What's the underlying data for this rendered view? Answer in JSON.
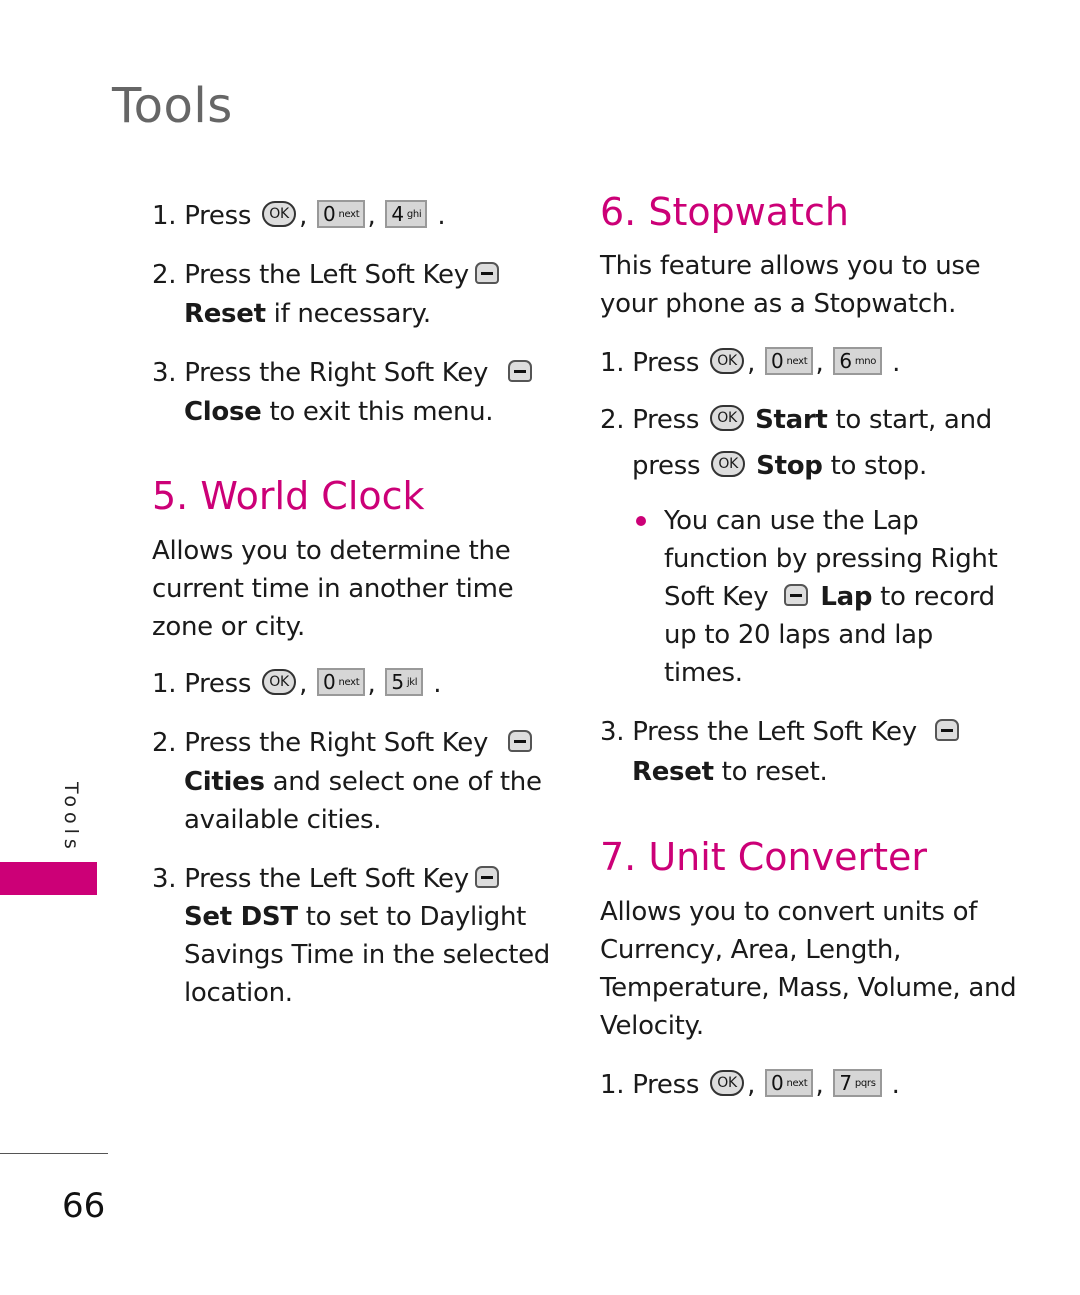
{
  "page": {
    "title": "Tools",
    "side_tab": "Tools",
    "page_number": "66",
    "accent_color": "#cc0077"
  },
  "intro_steps": [
    {
      "num": "1.",
      "text": "Press",
      "keys": [
        "OK",
        "0 next",
        "4 ghi"
      ]
    },
    {
      "num": "2.",
      "text": "Press the Left Soft Key",
      "bold": "Reset",
      "rest": "if necessary."
    },
    {
      "num": "3.",
      "text": "Press the Right Soft Key",
      "bold": "Close",
      "rest": "to exit this menu."
    }
  ],
  "world_clock": {
    "heading": "5. World Clock",
    "description": [
      "Allows you to determine the",
      "current time in another time",
      "zone or city."
    ],
    "step1": {
      "num": "1.",
      "text": "Press",
      "keys": {
        "ok": "OK",
        "k1": "0",
        "k1sub": "next",
        "k2": "5",
        "k2sub": "jkl"
      }
    },
    "step2": {
      "num": "2.",
      "text": "Press the Right Soft Key",
      "bold": "Cities",
      "rest": "and select one of the",
      "line3": "available cities."
    },
    "step3": {
      "num": "3.",
      "text": "Press the Left Soft Key",
      "bold": "Set DST",
      "rest": "to set to Daylight",
      "line3": "Savings Time in the selected",
      "line4": "location."
    }
  },
  "intro_keys": {
    "ok": "OK",
    "k1": "0",
    "k1sub": "next",
    "k2": "4",
    "k2sub": "ghi"
  },
  "stopwatch": {
    "heading": "6. Stopwatch",
    "description": [
      "This feature allows you to use",
      "your phone as a Stopwatch."
    ],
    "step1": {
      "num": "1.",
      "text": "Press",
      "keys": {
        "ok": "OK",
        "k1": "0",
        "k1sub": "next",
        "k2": "6",
        "k2sub": "mno"
      }
    },
    "step2": {
      "num": "2.",
      "text": "Press",
      "ok": "OK",
      "bold1": "Start",
      "rest1": "to start, and",
      "text2": "press",
      "bold2": "Stop",
      "rest2": "to stop."
    },
    "bullet": {
      "line1": "You can use the Lap",
      "line2": "function by pressing Right",
      "line3a": "Soft Key",
      "bold": "Lap",
      "line3b": "to record",
      "line4": "up to 20 laps and lap",
      "line5": "times."
    },
    "step3": {
      "num": "3.",
      "text": "Press the Left Soft Key",
      "bold": "Reset",
      "rest": "to reset."
    }
  },
  "unit_converter": {
    "heading": "7. Unit Converter",
    "description": [
      "Allows you to convert units of",
      "Currency, Area, Length,",
      "Temperature, Mass, Volume, and",
      "Velocity."
    ],
    "step1": {
      "num": "1.",
      "text": "Press",
      "keys": {
        "ok": "OK",
        "k1": "0",
        "k1sub": "next",
        "k2": "7",
        "k2sub": "pqrs"
      }
    }
  },
  "punct": {
    "comma": ",",
    "period": "."
  }
}
